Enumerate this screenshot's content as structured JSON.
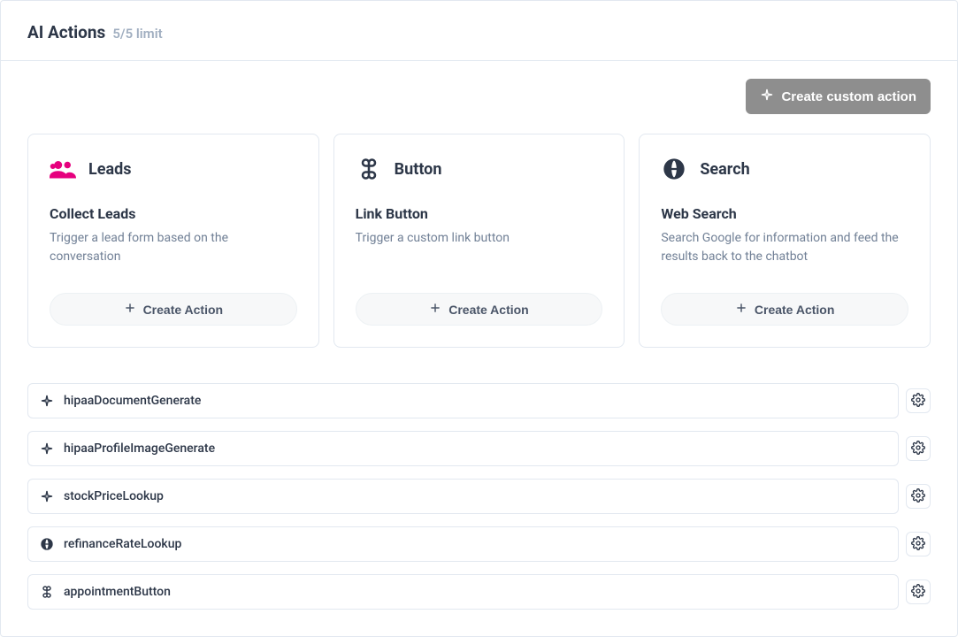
{
  "header": {
    "title": "AI Actions",
    "limit": "5/5 limit"
  },
  "customButton": {
    "label": "Create custom action"
  },
  "cards": [
    {
      "category": "Leads",
      "title": "Collect Leads",
      "description": "Trigger a lead form based on the conversation",
      "button": "Create Action",
      "iconName": "users-icon"
    },
    {
      "category": "Button",
      "title": "Link Button",
      "description": "Trigger a custom link button",
      "button": "Create Action",
      "iconName": "command-icon"
    },
    {
      "category": "Search",
      "title": "Web Search",
      "description": "Search Google for information and feed the results back to the chatbot",
      "button": "Create Action",
      "iconName": "globe-icon"
    }
  ],
  "actions": [
    {
      "name": "hipaaDocumentGenerate",
      "iconName": "sparkle-icon"
    },
    {
      "name": "hipaaProfileImageGenerate",
      "iconName": "sparkle-icon"
    },
    {
      "name": "stockPriceLookup",
      "iconName": "sparkle-icon"
    },
    {
      "name": "refinanceRateLookup",
      "iconName": "globe-icon"
    },
    {
      "name": "appointmentButton",
      "iconName": "command-icon"
    }
  ]
}
